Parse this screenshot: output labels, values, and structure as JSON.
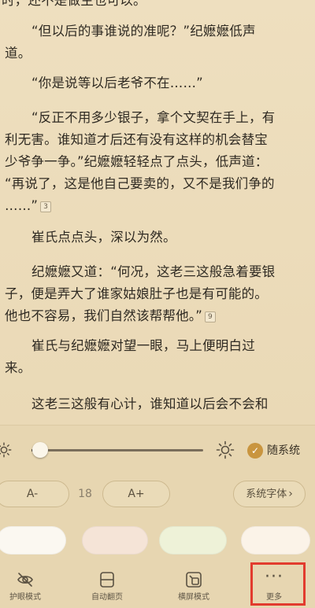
{
  "reader": {
    "lines": [
      "时，还不是做主也可以。",
      "“但以后的事谁说的准呢？”纪嬷嬷低声",
      "道。",
      "“你是说等以后老爷不在……”",
      "“反正不用多少银子，拿个文契在手上，有",
      "利无害。谁知道才后还有没有这样的机会替宝",
      "少爷争一争。”纪嬷嬷轻轻点了点头，低声道：",
      "“再说了，这是他自己要卖的，又不是我们争的",
      "……”",
      "崔氏点点头，深以为然。",
      "纪嬷嬷又道：“何况，这老三这般急着要银",
      "子，便是弄大了谁家姑娘肚子也是有可能的。",
      "他也不容易，我们自然该帮帮他。”",
      "崔氏与纪嬷嬷对望一眼，马上便明白过",
      "来。",
      "这老三这般有心计，谁知道以后会不会和"
    ],
    "note_badge_1": "3",
    "note_badge_2": "9"
  },
  "panel": {
    "brightness_level": 0.05,
    "follow_system_label": "随系统",
    "font_decrease_label": "A-",
    "font_size_value": "18",
    "font_increase_label": "A+",
    "font_family_label": "系统字体",
    "themes": [
      "#fbf8f1",
      "#f5e4d7",
      "#eef2d8",
      "#fbf3e8"
    ]
  },
  "toolbar": {
    "eye_label": "护眼模式",
    "auto_label": "自动翻页",
    "mode_label": "横屏模式",
    "more_label": "更多"
  },
  "colors": {
    "accent": "#c9953f",
    "highlight": "#e23b2e"
  }
}
